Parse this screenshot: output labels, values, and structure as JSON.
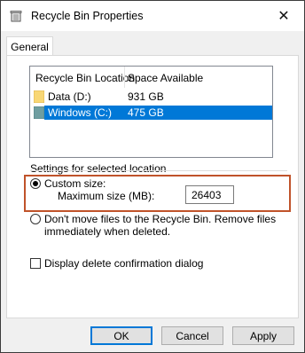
{
  "window": {
    "title": "Recycle Bin Properties",
    "close_glyph": "✕"
  },
  "tabs": [
    {
      "label": "General"
    }
  ],
  "list": {
    "headers": [
      "Recycle Bin Location",
      "Space Available"
    ],
    "rows": [
      {
        "location": "Data (D:)",
        "space": "931 GB",
        "selected": false
      },
      {
        "location": "Windows (C:)",
        "space": "475 GB",
        "selected": true
      }
    ]
  },
  "settings": {
    "group_label": "Settings for selected location",
    "custom_size_label": "Custom size:",
    "max_size_label": "Maximum size (MB):",
    "max_size_value": "26403",
    "dont_move_label_line1": "Don't move files to the Recycle Bin. Remove files",
    "dont_move_label_line2": "immediately when deleted.",
    "confirm_dialog_label": "Display delete confirmation dialog"
  },
  "buttons": {
    "ok": "OK",
    "cancel": "Cancel",
    "apply": "Apply"
  },
  "colors": {
    "selection": "#0078d7",
    "annotation_box": "#c0532a",
    "folder": "#f8d775"
  }
}
